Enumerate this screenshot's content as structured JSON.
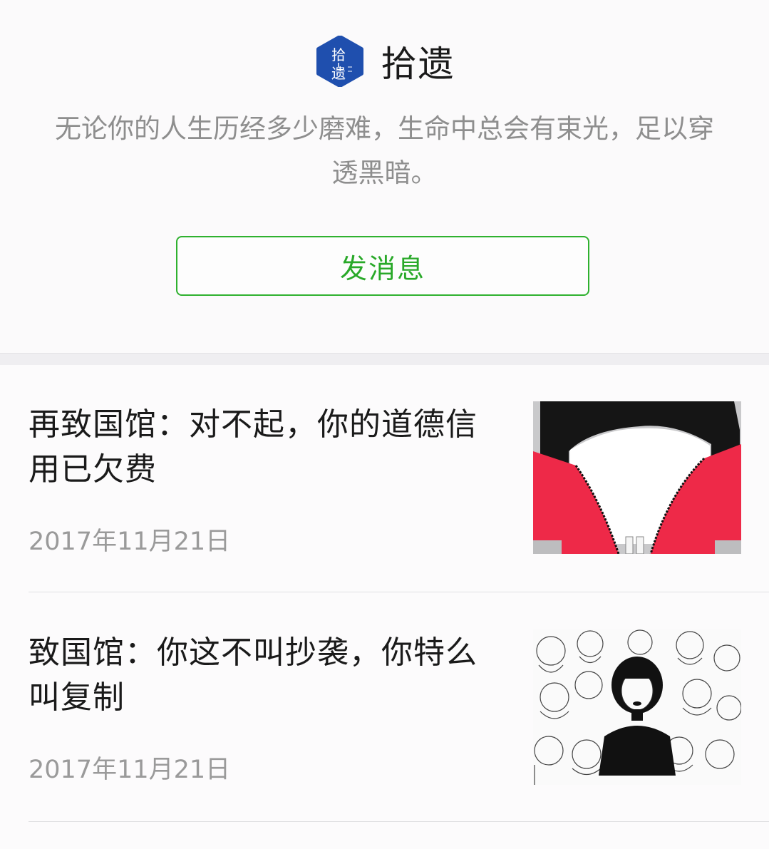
{
  "account": {
    "name": "拾遗",
    "logo_text_top": "拾",
    "logo_text_bottom": "遗",
    "bio": "无论你的人生历经多少磨难，生命中总会有束光，足以穿透黑暗。",
    "message_button_label": "发消息",
    "brand_color": "#1f4fae",
    "button_color": "#2fb12f"
  },
  "articles": [
    {
      "title": "再致国馆：对不起，你的道德信用已欠费",
      "date": "2017年11月21日",
      "thumbnail": "illustration-red-collar-figure"
    },
    {
      "title": "致国馆：你这不叫抄袭，你特么叫复制",
      "date": "2017年11月21日",
      "thumbnail": "illustration-crowd-of-girls"
    }
  ]
}
